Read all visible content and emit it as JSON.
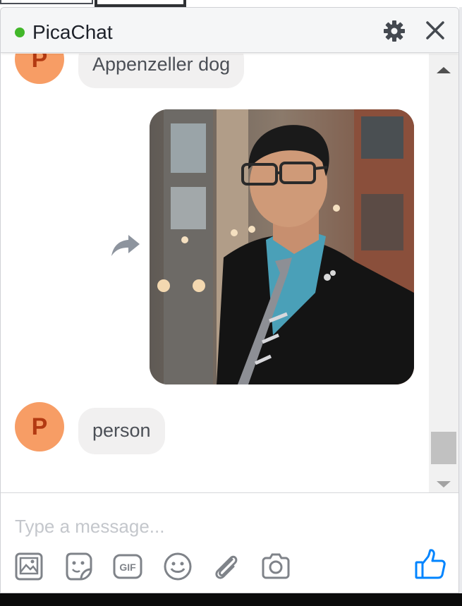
{
  "header": {
    "title": "PicaChat",
    "status_color": "#42b72a"
  },
  "messages": [
    {
      "sender": "other",
      "avatar_letter": "P",
      "text": "Appenzeller dog"
    },
    {
      "sender": "self",
      "type": "image",
      "image": "photo of a man in a suit and glasses",
      "action_icon": "forward-icon"
    },
    {
      "sender": "other",
      "avatar_letter": "P",
      "text": "person"
    }
  ],
  "composer": {
    "placeholder": "Type a message...",
    "tools": [
      "photo-icon",
      "sticker-icon",
      "gif-icon",
      "emoji-icon",
      "attachment-icon",
      "camera-icon"
    ],
    "send_icon": "thumbs-up-icon"
  },
  "colors": {
    "accent": "#0084ff",
    "avatar_bg": "#f79d65",
    "avatar_letter": "#b33a12",
    "bubble_bg": "#f1f0f0"
  }
}
